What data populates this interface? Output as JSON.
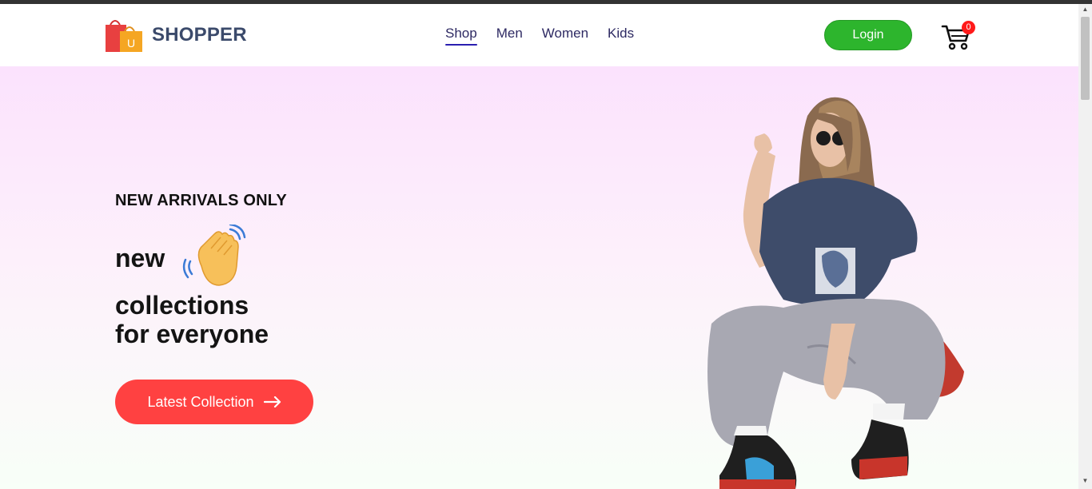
{
  "brand": {
    "name": "SHOPPER",
    "bag_letter": "U"
  },
  "nav": {
    "items": [
      {
        "label": "Shop",
        "active": true
      },
      {
        "label": "Men",
        "active": false
      },
      {
        "label": "Women",
        "active": false
      },
      {
        "label": "Kids",
        "active": false
      }
    ],
    "login_label": "Login",
    "cart_count": "0"
  },
  "hero": {
    "kicker": "NEW ARRIVALS ONLY",
    "line1": "new",
    "line2": "collections",
    "line3": "for everyone",
    "cta_label": "Latest Collection",
    "cta_icon": "arrow-right-icon"
  },
  "colors": {
    "accent": "#ff4141",
    "login": "#2db52d",
    "brand_text": "#3b4a6b",
    "nav_active": "#2a1fb0",
    "hero_top": "#fbe2fd",
    "hero_bottom": "#f8fff8"
  },
  "scrollbar": {
    "up_glyph": "▲",
    "down_glyph": "▼"
  }
}
